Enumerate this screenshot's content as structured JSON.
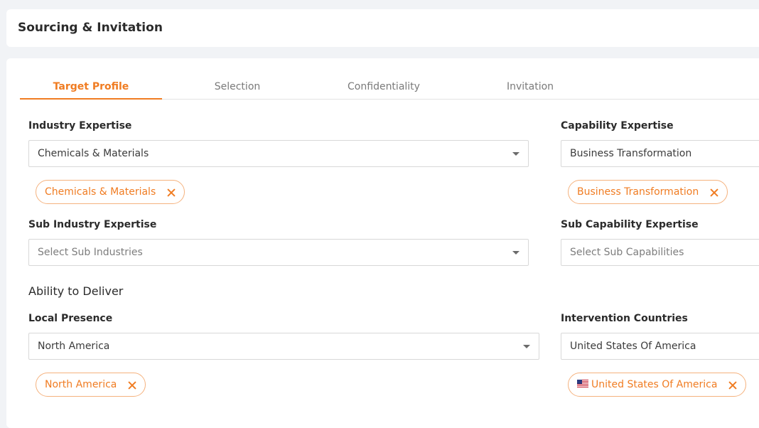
{
  "header": {
    "title": "Sourcing & Invitation"
  },
  "tabs": [
    {
      "label": "Target Profile",
      "active": true
    },
    {
      "label": "Selection",
      "active": false
    },
    {
      "label": "Confidentiality",
      "active": false
    },
    {
      "label": "Invitation",
      "active": false
    }
  ],
  "industry": {
    "label": "Industry Expertise",
    "value": "Chemicals & Materials",
    "chip": "Chemicals & Materials"
  },
  "capability": {
    "label": "Capability Expertise",
    "value": "Business Transformation",
    "chip": "Business Transformation"
  },
  "sub_industry": {
    "label": "Sub Industry Expertise",
    "placeholder": "Select Sub Industries"
  },
  "sub_capability": {
    "label": "Sub Capability Expertise",
    "placeholder": "Select Sub Capabilities"
  },
  "ability": {
    "title": "Ability to Deliver"
  },
  "local_presence": {
    "label": "Local Presence",
    "value": "North America",
    "chip": "North America"
  },
  "intervention": {
    "label": "Intervention Countries",
    "value": "United States Of America",
    "chip": "United States Of America",
    "chip_icon": "us-flag-icon"
  },
  "colors": {
    "accent": "#f07c22",
    "chip_border": "#f5b27e",
    "background": "#f1f3f6"
  }
}
